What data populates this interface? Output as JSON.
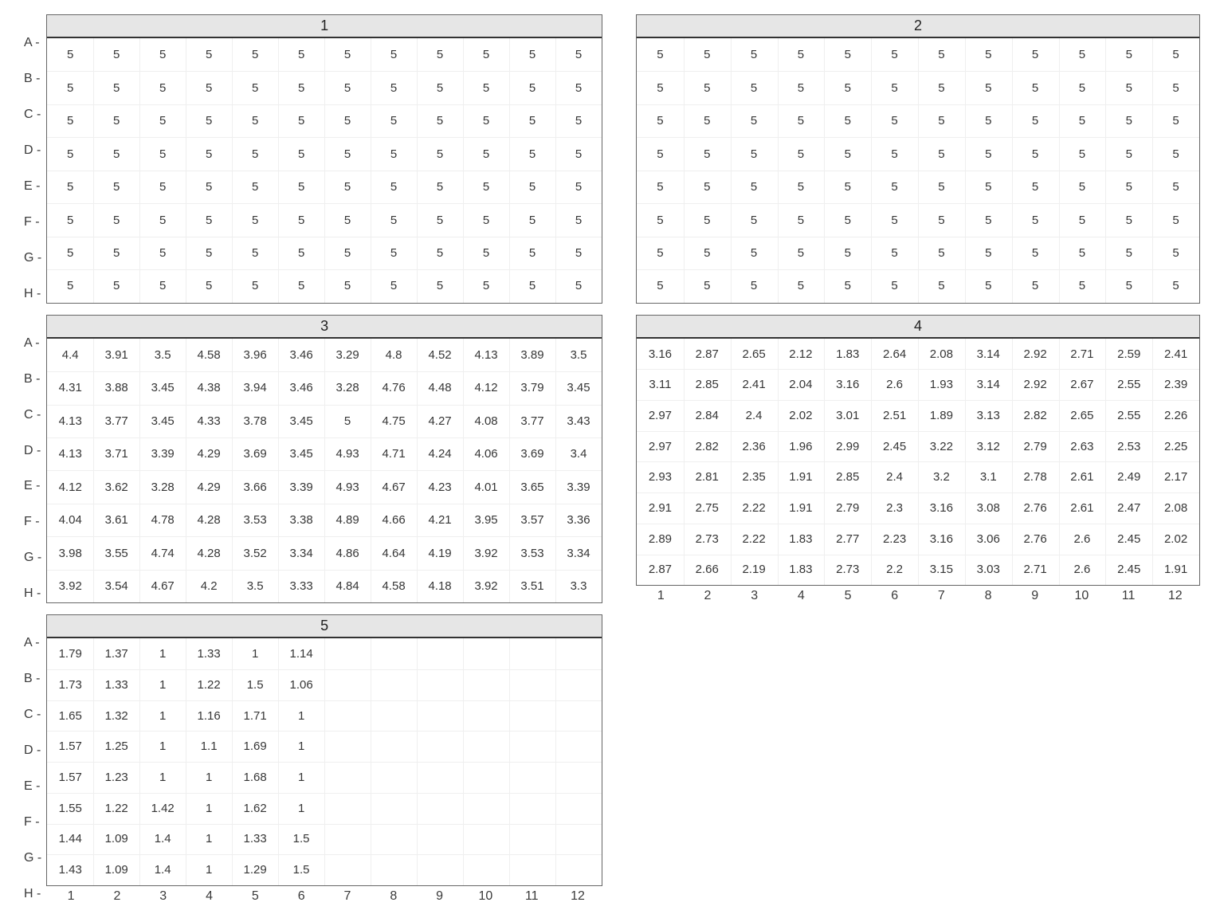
{
  "chart_data": {
    "type": "table",
    "row_labels": [
      "A",
      "B",
      "C",
      "D",
      "E",
      "F",
      "G",
      "H"
    ],
    "col_labels": [
      "1",
      "2",
      "3",
      "4",
      "5",
      "6",
      "7",
      "8",
      "9",
      "10",
      "11",
      "12"
    ],
    "panels": [
      {
        "title": "1",
        "show_y_axis": true,
        "show_x_axis": false,
        "values": [
          [
            "5",
            "5",
            "5",
            "5",
            "5",
            "5",
            "5",
            "5",
            "5",
            "5",
            "5",
            "5"
          ],
          [
            "5",
            "5",
            "5",
            "5",
            "5",
            "5",
            "5",
            "5",
            "5",
            "5",
            "5",
            "5"
          ],
          [
            "5",
            "5",
            "5",
            "5",
            "5",
            "5",
            "5",
            "5",
            "5",
            "5",
            "5",
            "5"
          ],
          [
            "5",
            "5",
            "5",
            "5",
            "5",
            "5",
            "5",
            "5",
            "5",
            "5",
            "5",
            "5"
          ],
          [
            "5",
            "5",
            "5",
            "5",
            "5",
            "5",
            "5",
            "5",
            "5",
            "5",
            "5",
            "5"
          ],
          [
            "5",
            "5",
            "5",
            "5",
            "5",
            "5",
            "5",
            "5",
            "5",
            "5",
            "5",
            "5"
          ],
          [
            "5",
            "5",
            "5",
            "5",
            "5",
            "5",
            "5",
            "5",
            "5",
            "5",
            "5",
            "5"
          ],
          [
            "5",
            "5",
            "5",
            "5",
            "5",
            "5",
            "5",
            "5",
            "5",
            "5",
            "5",
            "5"
          ]
        ]
      },
      {
        "title": "2",
        "show_y_axis": false,
        "show_x_axis": false,
        "values": [
          [
            "5",
            "5",
            "5",
            "5",
            "5",
            "5",
            "5",
            "5",
            "5",
            "5",
            "5",
            "5"
          ],
          [
            "5",
            "5",
            "5",
            "5",
            "5",
            "5",
            "5",
            "5",
            "5",
            "5",
            "5",
            "5"
          ],
          [
            "5",
            "5",
            "5",
            "5",
            "5",
            "5",
            "5",
            "5",
            "5",
            "5",
            "5",
            "5"
          ],
          [
            "5",
            "5",
            "5",
            "5",
            "5",
            "5",
            "5",
            "5",
            "5",
            "5",
            "5",
            "5"
          ],
          [
            "5",
            "5",
            "5",
            "5",
            "5",
            "5",
            "5",
            "5",
            "5",
            "5",
            "5",
            "5"
          ],
          [
            "5",
            "5",
            "5",
            "5",
            "5",
            "5",
            "5",
            "5",
            "5",
            "5",
            "5",
            "5"
          ],
          [
            "5",
            "5",
            "5",
            "5",
            "5",
            "5",
            "5",
            "5",
            "5",
            "5",
            "5",
            "5"
          ],
          [
            "5",
            "5",
            "5",
            "5",
            "5",
            "5",
            "5",
            "5",
            "5",
            "5",
            "5",
            "5"
          ]
        ]
      },
      {
        "title": "3",
        "show_y_axis": true,
        "show_x_axis": false,
        "values": [
          [
            "4.4",
            "3.91",
            "3.5",
            "4.58",
            "3.96",
            "3.46",
            "3.29",
            "4.8",
            "4.52",
            "4.13",
            "3.89",
            "3.5"
          ],
          [
            "4.31",
            "3.88",
            "3.45",
            "4.38",
            "3.94",
            "3.46",
            "3.28",
            "4.76",
            "4.48",
            "4.12",
            "3.79",
            "3.45"
          ],
          [
            "4.13",
            "3.77",
            "3.45",
            "4.33",
            "3.78",
            "3.45",
            "5",
            "4.75",
            "4.27",
            "4.08",
            "3.77",
            "3.43"
          ],
          [
            "4.13",
            "3.71",
            "3.39",
            "4.29",
            "3.69",
            "3.45",
            "4.93",
            "4.71",
            "4.24",
            "4.06",
            "3.69",
            "3.4"
          ],
          [
            "4.12",
            "3.62",
            "3.28",
            "4.29",
            "3.66",
            "3.39",
            "4.93",
            "4.67",
            "4.23",
            "4.01",
            "3.65",
            "3.39"
          ],
          [
            "4.04",
            "3.61",
            "4.78",
            "4.28",
            "3.53",
            "3.38",
            "4.89",
            "4.66",
            "4.21",
            "3.95",
            "3.57",
            "3.36"
          ],
          [
            "3.98",
            "3.55",
            "4.74",
            "4.28",
            "3.52",
            "3.34",
            "4.86",
            "4.64",
            "4.19",
            "3.92",
            "3.53",
            "3.34"
          ],
          [
            "3.92",
            "3.54",
            "4.67",
            "4.2",
            "3.5",
            "3.33",
            "4.84",
            "4.58",
            "4.18",
            "3.92",
            "3.51",
            "3.3"
          ]
        ]
      },
      {
        "title": "4",
        "show_y_axis": false,
        "show_x_axis": true,
        "values": [
          [
            "3.16",
            "2.87",
            "2.65",
            "2.12",
            "1.83",
            "2.64",
            "2.08",
            "3.14",
            "2.92",
            "2.71",
            "2.59",
            "2.41"
          ],
          [
            "3.11",
            "2.85",
            "2.41",
            "2.04",
            "3.16",
            "2.6",
            "1.93",
            "3.14",
            "2.92",
            "2.67",
            "2.55",
            "2.39"
          ],
          [
            "2.97",
            "2.84",
            "2.4",
            "2.02",
            "3.01",
            "2.51",
            "1.89",
            "3.13",
            "2.82",
            "2.65",
            "2.55",
            "2.26"
          ],
          [
            "2.97",
            "2.82",
            "2.36",
            "1.96",
            "2.99",
            "2.45",
            "3.22",
            "3.12",
            "2.79",
            "2.63",
            "2.53",
            "2.25"
          ],
          [
            "2.93",
            "2.81",
            "2.35",
            "1.91",
            "2.85",
            "2.4",
            "3.2",
            "3.1",
            "2.78",
            "2.61",
            "2.49",
            "2.17"
          ],
          [
            "2.91",
            "2.75",
            "2.22",
            "1.91",
            "2.79",
            "2.3",
            "3.16",
            "3.08",
            "2.76",
            "2.61",
            "2.47",
            "2.08"
          ],
          [
            "2.89",
            "2.73",
            "2.22",
            "1.83",
            "2.77",
            "2.23",
            "3.16",
            "3.06",
            "2.76",
            "2.6",
            "2.45",
            "2.02"
          ],
          [
            "2.87",
            "2.66",
            "2.19",
            "1.83",
            "2.73",
            "2.2",
            "3.15",
            "3.03",
            "2.71",
            "2.6",
            "2.45",
            "1.91"
          ]
        ]
      },
      {
        "title": "5",
        "show_y_axis": true,
        "show_x_axis": true,
        "values": [
          [
            "1.79",
            "1.37",
            "1",
            "1.33",
            "1",
            "1.14",
            "",
            "",
            "",
            "",
            "",
            ""
          ],
          [
            "1.73",
            "1.33",
            "1",
            "1.22",
            "1.5",
            "1.06",
            "",
            "",
            "",
            "",
            "",
            ""
          ],
          [
            "1.65",
            "1.32",
            "1",
            "1.16",
            "1.71",
            "1",
            "",
            "",
            "",
            "",
            "",
            ""
          ],
          [
            "1.57",
            "1.25",
            "1",
            "1.1",
            "1.69",
            "1",
            "",
            "",
            "",
            "",
            "",
            ""
          ],
          [
            "1.57",
            "1.23",
            "1",
            "1",
            "1.68",
            "1",
            "",
            "",
            "",
            "",
            "",
            ""
          ],
          [
            "1.55",
            "1.22",
            "1.42",
            "1",
            "1.62",
            "1",
            "",
            "",
            "",
            "",
            "",
            ""
          ],
          [
            "1.44",
            "1.09",
            "1.4",
            "1",
            "1.33",
            "1.5",
            "",
            "",
            "",
            "",
            "",
            ""
          ],
          [
            "1.43",
            "1.09",
            "1.4",
            "1",
            "1.29",
            "1.5",
            "",
            "",
            "",
            "",
            "",
            ""
          ]
        ]
      }
    ]
  }
}
